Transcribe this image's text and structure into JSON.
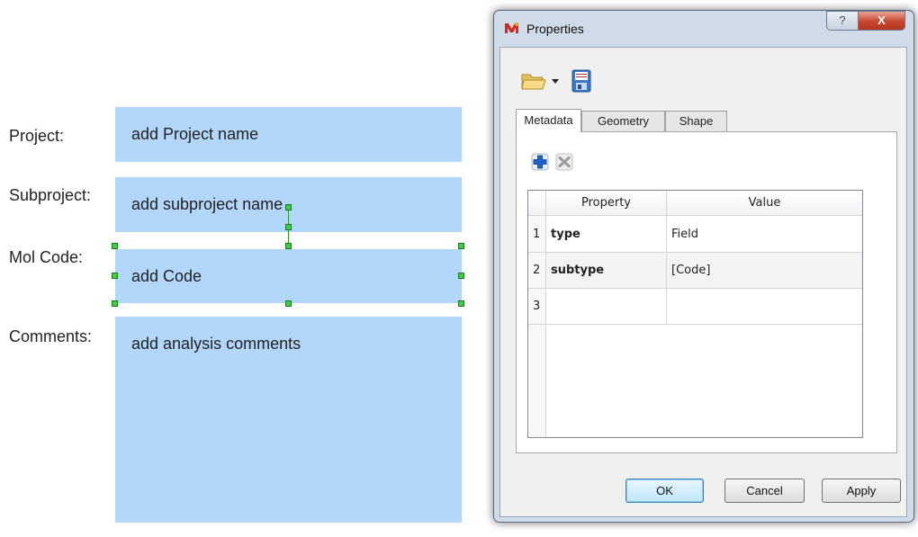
{
  "form": {
    "fields": [
      {
        "label": "Project:",
        "value": "add Project name"
      },
      {
        "label": "Subproject:",
        "value": "add subproject name"
      },
      {
        "label": "Mol Code:",
        "value": "add Code"
      },
      {
        "label": "Comments:",
        "value": "add analysis comments"
      }
    ]
  },
  "dialog": {
    "title": "Properties",
    "title_buttons": {
      "help": "?",
      "close": "X"
    },
    "toolbar": {
      "open_icon": "folder-open-icon",
      "save_icon": "floppy-save-icon"
    },
    "tabs": [
      {
        "label": "Metadata",
        "active": true
      },
      {
        "label": "Geometry",
        "active": false
      },
      {
        "label": "Shape",
        "active": false
      }
    ],
    "table_toolbar": {
      "add_icon": "plus-icon",
      "remove_icon": "delete-x-icon"
    },
    "table": {
      "columns": [
        "Property",
        "Value"
      ],
      "rows": [
        {
          "num": "1",
          "property": "type",
          "value": "Field"
        },
        {
          "num": "2",
          "property": "subtype",
          "value": "[Code]"
        },
        {
          "num": "3",
          "property": "",
          "value": ""
        }
      ]
    },
    "buttons": {
      "ok": "OK",
      "cancel": "Cancel",
      "apply": "Apply"
    }
  },
  "colors": {
    "field_fill": "#b3d7fb",
    "selection_handle": "#3cd13c",
    "close_button": "#c8472f",
    "dialog_frame": "#cfdbe8"
  }
}
